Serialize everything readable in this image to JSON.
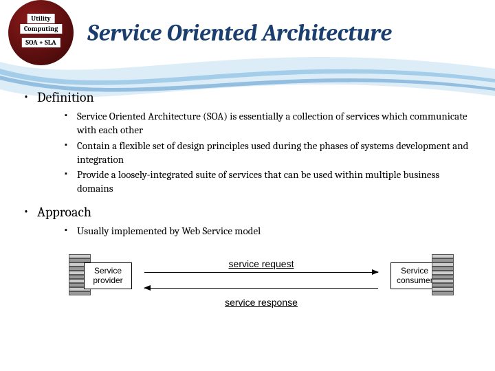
{
  "badge": {
    "line1": "Utility",
    "line2": "Computing",
    "line3": "SOA + SLA"
  },
  "title": "Service Oriented Architecture",
  "sections": [
    {
      "heading": "Definition",
      "items": [
        "Service Oriented Architecture (SOA) is essentially a collection of services which communicate with each other",
        "Contain a flexible set of design principles used during the phases of systems development and integration",
        "Provide a loosely-integrated suite of services that can be used within multiple business domains"
      ]
    },
    {
      "heading": "Approach",
      "items": [
        "Usually implemented by Web Service model"
      ]
    }
  ],
  "diagram": {
    "provider_label": "Service provider",
    "consumer_label": "Service consumer",
    "request_label": "service request",
    "response_label": "service response"
  }
}
